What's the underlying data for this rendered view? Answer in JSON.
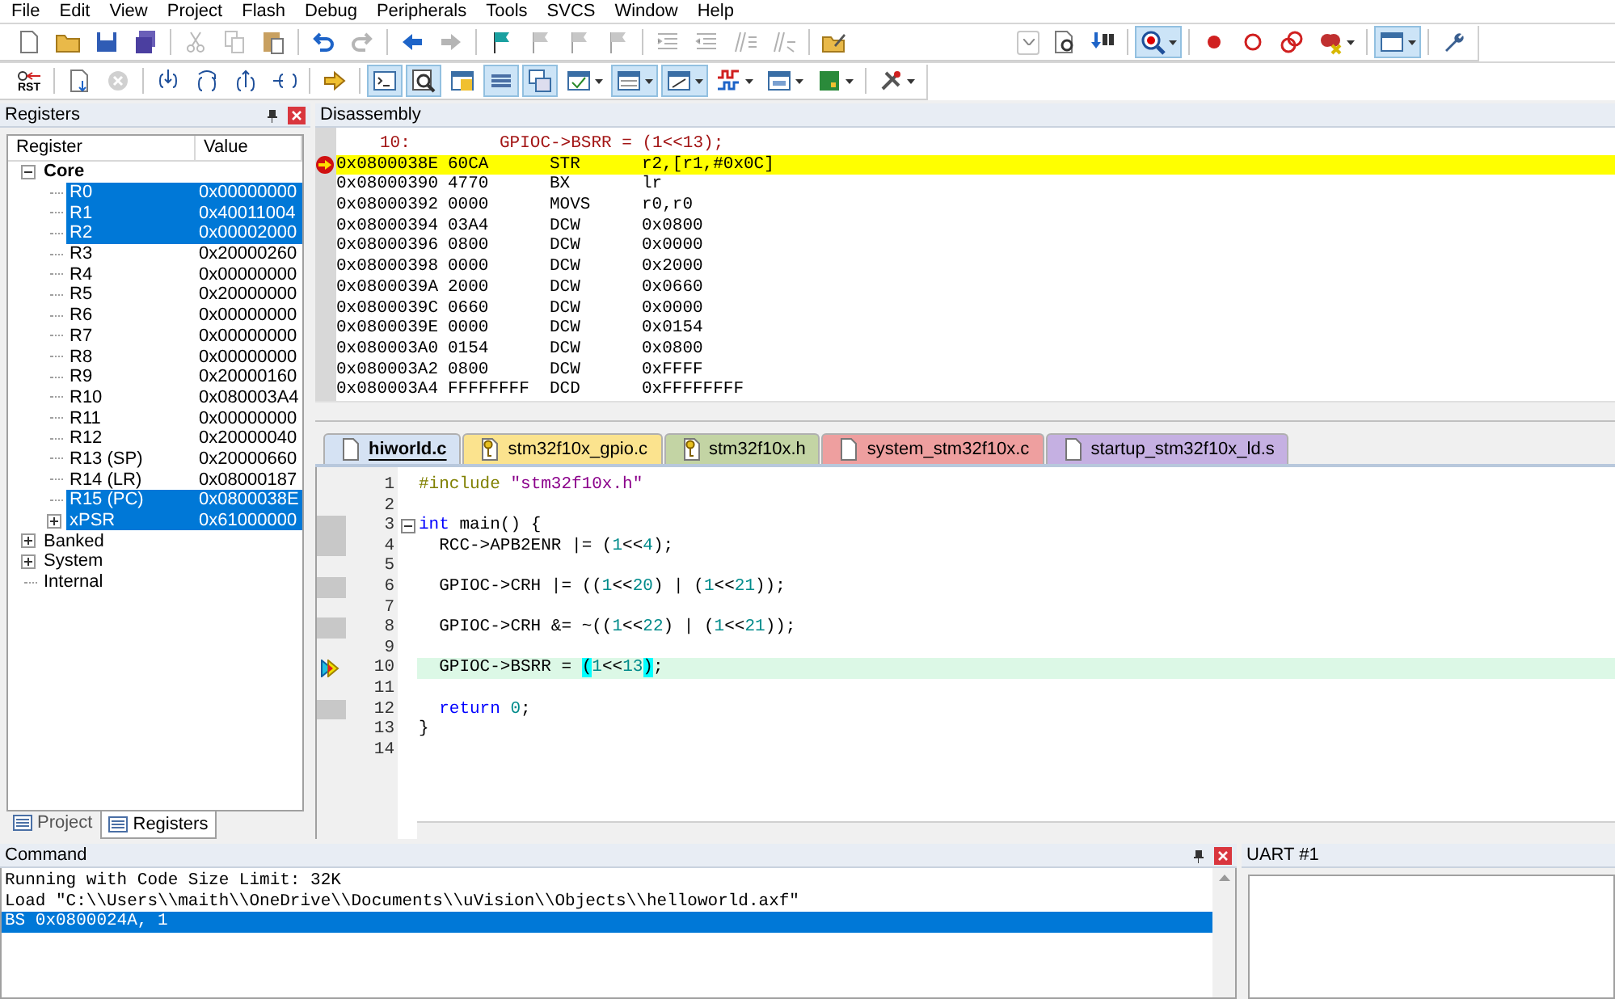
{
  "menu": [
    "File",
    "Edit",
    "View",
    "Project",
    "Flash",
    "Debug",
    "Peripherals",
    "Tools",
    "SVCS",
    "Window",
    "Help"
  ],
  "toolbars": [
    {
      "buttons": [
        {
          "pressed": false,
          "disabled": false
        },
        {
          "pressed": false,
          "disabled": false
        },
        {
          "pressed": false,
          "disabled": false
        },
        {
          "pressed": false,
          "disabled": false
        },
        {
          "pressed": false,
          "disabled": true
        },
        {
          "pressed": false,
          "disabled": true
        },
        {
          "pressed": false,
          "disabled": false
        },
        {
          "pressed": false,
          "disabled": false
        },
        {
          "pressed": false,
          "disabled": true
        },
        {
          "pressed": false,
          "disabled": false
        },
        {
          "pressed": false,
          "disabled": true
        },
        {
          "pressed": false,
          "disabled": false
        },
        {
          "pressed": false,
          "disabled": true
        },
        {
          "pressed": false,
          "disabled": true
        },
        {
          "pressed": false,
          "disabled": true
        },
        {
          "pressed": false,
          "disabled": true
        },
        {
          "pressed": false,
          "disabled": true
        },
        {
          "pressed": false,
          "disabled": true
        },
        {
          "pressed": false,
          "disabled": true
        },
        {
          "pressed": false,
          "disabled": false
        },
        {
          "pressed": false,
          "disabled": false
        },
        {
          "pressed": false,
          "disabled": false
        },
        {
          "pressed": true,
          "disabled": false
        },
        {
          "pressed": false,
          "disabled": false
        },
        {
          "pressed": false,
          "disabled": false
        },
        {
          "pressed": false,
          "disabled": false
        },
        {
          "pressed": false,
          "disabled": false
        },
        {
          "pressed": true,
          "disabled": false
        },
        {
          "pressed": false,
          "disabled": false
        }
      ]
    },
    {
      "buttons": [
        {
          "label": "RST",
          "pressed": false,
          "disabled": false
        },
        {
          "pressed": false,
          "disabled": false
        },
        {
          "pressed": false,
          "disabled": true
        },
        {
          "pressed": false,
          "disabled": false
        },
        {
          "pressed": false,
          "disabled": false
        },
        {
          "pressed": false,
          "disabled": false
        },
        {
          "pressed": false,
          "disabled": false
        },
        {
          "pressed": false,
          "disabled": false
        },
        {
          "pressed": true,
          "disabled": false
        },
        {
          "pressed": true,
          "disabled": false
        },
        {
          "pressed": false,
          "disabled": false
        },
        {
          "pressed": true,
          "disabled": false
        },
        {
          "pressed": true,
          "disabled": false
        },
        {
          "pressed": false,
          "disabled": false
        },
        {
          "pressed": true,
          "disabled": false
        },
        {
          "pressed": true,
          "disabled": false
        },
        {
          "pressed": false,
          "disabled": false
        },
        {
          "pressed": false,
          "disabled": false
        },
        {
          "pressed": false,
          "disabled": false
        },
        {
          "pressed": false,
          "disabled": false
        }
      ]
    }
  ],
  "registers": {
    "title": "Registers",
    "columns": [
      "Register",
      "Value"
    ],
    "tree": [
      {
        "label": "Core",
        "selected": false,
        "expanded": true,
        "children": [
          {
            "label": "R0",
            "value": "0x00000000",
            "selected": true
          },
          {
            "label": "R1",
            "value": "0x40011004",
            "selected": true
          },
          {
            "label": "R2",
            "value": "0x00002000",
            "selected": true
          },
          {
            "label": "R3",
            "value": "0x20000260",
            "selected": false
          },
          {
            "label": "R4",
            "value": "0x00000000",
            "selected": false
          },
          {
            "label": "R5",
            "value": "0x20000000",
            "selected": false
          },
          {
            "label": "R6",
            "value": "0x00000000",
            "selected": false
          },
          {
            "label": "R7",
            "value": "0x00000000",
            "selected": false
          },
          {
            "label": "R8",
            "value": "0x00000000",
            "selected": false
          },
          {
            "label": "R9",
            "value": "0x20000160",
            "selected": false
          },
          {
            "label": "R10",
            "value": "0x080003A4",
            "selected": false
          },
          {
            "label": "R11",
            "value": "0x00000000",
            "selected": false
          },
          {
            "label": "R12",
            "value": "0x20000040",
            "selected": false
          },
          {
            "label": "R13 (SP)",
            "value": "0x20000660",
            "selected": false
          },
          {
            "label": "R14 (LR)",
            "value": "0x08000187",
            "selected": false
          },
          {
            "label": "R15 (PC)",
            "value": "0x0800038E",
            "selected": true
          },
          {
            "label": "xPSR",
            "value": "0x61000000",
            "selected": true,
            "expanded": false
          }
        ]
      },
      {
        "label": "Banked",
        "selected": false,
        "expanded": false
      },
      {
        "label": "System",
        "selected": false,
        "expanded": false
      },
      {
        "label": "Internal",
        "selected": false
      }
    ],
    "tabs": [
      {
        "label": "Project",
        "selected": false
      },
      {
        "label": "Registers",
        "selected": true
      }
    ]
  },
  "disassembly": {
    "title": "Disassembly",
    "source": {
      "line_no": "10:",
      "code": "GPIOC->BSRR = (1<<13);"
    },
    "rows": [
      {
        "address": "0x0800038E",
        "opcode": "60CA",
        "mnemonic": "STR",
        "operand": "r2,[r1,#0x0C]",
        "current": true
      },
      {
        "address": "0x08000390",
        "opcode": "4770",
        "mnemonic": "BX",
        "operand": "lr",
        "current": false
      },
      {
        "address": "0x08000392",
        "opcode": "0000",
        "mnemonic": "MOVS",
        "operand": "r0,r0",
        "current": false
      },
      {
        "address": "0x08000394",
        "opcode": "03A4",
        "mnemonic": "DCW",
        "operand": "0x0800",
        "current": false
      },
      {
        "address": "0x08000396",
        "opcode": "0800",
        "mnemonic": "DCW",
        "operand": "0x0000",
        "current": false
      },
      {
        "address": "0x08000398",
        "opcode": "0000",
        "mnemonic": "DCW",
        "operand": "0x2000",
        "current": false
      },
      {
        "address": "0x0800039A",
        "opcode": "2000",
        "mnemonic": "DCW",
        "operand": "0x0660",
        "current": false
      },
      {
        "address": "0x0800039C",
        "opcode": "0660",
        "mnemonic": "DCW",
        "operand": "0x0000",
        "current": false
      },
      {
        "address": "0x0800039E",
        "opcode": "0000",
        "mnemonic": "DCW",
        "operand": "0x0154",
        "current": false
      },
      {
        "address": "0x080003A0",
        "opcode": "0154",
        "mnemonic": "DCW",
        "operand": "0x0800",
        "current": false
      },
      {
        "address": "0x080003A2",
        "opcode": "0800",
        "mnemonic": "DCW",
        "operand": "0xFFFF",
        "current": false
      },
      {
        "address": "0x080003A4",
        "opcode": "FFFFFFFF",
        "mnemonic": "DCD",
        "operand": "0xFFFFFFFF",
        "current": false
      }
    ]
  },
  "editor": {
    "tabs": [
      {
        "label": "hiworld.c",
        "selected": true,
        "read_only": false,
        "color": "#d5e2f3"
      },
      {
        "label": "stm32f10x_gpio.c",
        "selected": false,
        "read_only": true,
        "color": "#fbe38e"
      },
      {
        "label": "stm32f10x.h",
        "selected": false,
        "read_only": true,
        "color": "#c3d4a4"
      },
      {
        "label": "system_stm32f10x.c",
        "selected": false,
        "read_only": false,
        "color": "#ee9f9f"
      },
      {
        "label": "startup_stm32f10x_ld.s",
        "selected": false,
        "read_only": false,
        "color": "#c5b0e2"
      }
    ],
    "lines": [
      {
        "n": "1",
        "executable": false,
        "current": false,
        "tokens": [
          {
            "text": "#include ",
            "kind": "preproc"
          },
          {
            "text": "\"stm32f10x.h\"",
            "kind": "string"
          }
        ]
      },
      {
        "n": "2",
        "executable": false,
        "current": false
      },
      {
        "n": "3",
        "executable": true,
        "current": false,
        "fold_open": true,
        "tokens": [
          {
            "text": "int",
            "kind": "keyword"
          },
          {
            "text": " main() {",
            "kind": "plain"
          }
        ]
      },
      {
        "n": "4",
        "executable": true,
        "current": false,
        "tokens": [
          {
            "text": "  RCC->APB2ENR |= (",
            "kind": "plain"
          },
          {
            "text": "1",
            "kind": "number"
          },
          {
            "text": "<<",
            "kind": "plain"
          },
          {
            "text": "4",
            "kind": "number"
          },
          {
            "text": ");",
            "kind": "plain"
          }
        ]
      },
      {
        "n": "5",
        "executable": false,
        "current": false
      },
      {
        "n": "6",
        "executable": true,
        "current": false,
        "tokens": [
          {
            "text": "  GPIOC->CRH |= ((",
            "kind": "plain"
          },
          {
            "text": "1",
            "kind": "number"
          },
          {
            "text": "<<",
            "kind": "plain"
          },
          {
            "text": "20",
            "kind": "number"
          },
          {
            "text": ") | (",
            "kind": "plain"
          },
          {
            "text": "1",
            "kind": "number"
          },
          {
            "text": "<<",
            "kind": "plain"
          },
          {
            "text": "21",
            "kind": "number"
          },
          {
            "text": "));",
            "kind": "plain"
          }
        ]
      },
      {
        "n": "7",
        "executable": false,
        "current": false
      },
      {
        "n": "8",
        "executable": true,
        "current": false,
        "tokens": [
          {
            "text": "  GPIOC->CRH &= ~((",
            "kind": "plain"
          },
          {
            "text": "1",
            "kind": "number"
          },
          {
            "text": "<<",
            "kind": "plain"
          },
          {
            "text": "22",
            "kind": "number"
          },
          {
            "text": ") | (",
            "kind": "plain"
          },
          {
            "text": "1",
            "kind": "number"
          },
          {
            "text": "<<",
            "kind": "plain"
          },
          {
            "text": "21",
            "kind": "number"
          },
          {
            "text": "));",
            "kind": "plain"
          }
        ]
      },
      {
        "n": "9",
        "executable": false,
        "current": false
      },
      {
        "n": "10",
        "executable": true,
        "current": true,
        "tokens": [
          {
            "text": "  GPIOC->BSRR = ",
            "kind": "plain"
          },
          {
            "text": "(",
            "kind": "brace_match"
          },
          {
            "text": "1",
            "kind": "number"
          },
          {
            "text": "<<",
            "kind": "plain"
          },
          {
            "text": "13",
            "kind": "number"
          },
          {
            "text": ")",
            "kind": "brace_match"
          },
          {
            "text": ";",
            "kind": "plain"
          }
        ]
      },
      {
        "n": "11",
        "executable": false,
        "current": false
      },
      {
        "n": "12",
        "executable": true,
        "current": false,
        "tokens": [
          {
            "text": "  return",
            "kind": "keyword"
          },
          {
            "text": " 0",
            "kind": "number"
          },
          {
            "text": ";",
            "kind": "plain"
          }
        ]
      },
      {
        "n": "13",
        "executable": false,
        "current": false,
        "tokens": [
          {
            "text": "}",
            "kind": "plain"
          }
        ]
      },
      {
        "n": "14",
        "executable": false,
        "current": false
      }
    ]
  },
  "command": {
    "title": "Command",
    "lines": [
      {
        "text": "Running with Code Size Limit: 32K",
        "selected": false
      },
      {
        "text": "Load \"C:\\\\Users\\\\maith\\\\OneDrive\\\\Documents\\\\uVision\\\\Objects\\\\helloworld.axf\"",
        "selected": false
      },
      {
        "text": "BS 0x0800024A, 1",
        "selected": true
      }
    ]
  },
  "uart": {
    "title": "UART #1"
  }
}
